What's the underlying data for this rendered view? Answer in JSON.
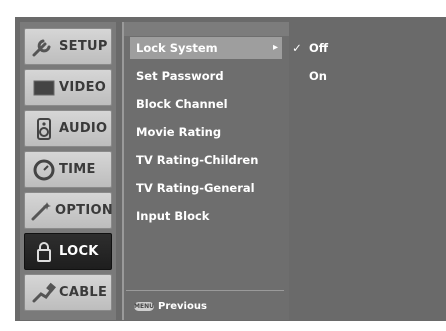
{
  "sidebar": {
    "items": [
      {
        "label": "SETUP",
        "icon": "wrench-icon",
        "active": false
      },
      {
        "label": "VIDEO",
        "icon": "tv-screen-icon",
        "active": false
      },
      {
        "label": "AUDIO",
        "icon": "speaker-icon",
        "active": false
      },
      {
        "label": "TIME",
        "icon": "clock-icon",
        "active": false
      },
      {
        "label": "OPTION",
        "icon": "wand-icon",
        "active": false
      },
      {
        "label": "LOCK",
        "icon": "padlock-icon",
        "active": true
      },
      {
        "label": "CABLE",
        "icon": "cable-plug-icon",
        "active": false
      }
    ]
  },
  "menu": {
    "items": [
      {
        "label": "Lock System",
        "selected": true
      },
      {
        "label": "Set Password",
        "selected": false
      },
      {
        "label": "Block Channel",
        "selected": false
      },
      {
        "label": "Movie Rating",
        "selected": false
      },
      {
        "label": "TV Rating-Children",
        "selected": false
      },
      {
        "label": "TV Rating-General",
        "selected": false
      },
      {
        "label": "Input Block",
        "selected": false
      }
    ],
    "footer_key": "MENU",
    "footer_label": "Previous"
  },
  "options": {
    "items": [
      {
        "label": "Off",
        "checked": true
      },
      {
        "label": "On",
        "checked": false
      }
    ]
  },
  "colors": {
    "panel_bg": "#6a6a6a",
    "selected_bg": "#9e9e9e",
    "active_tab": "#1e1e1e",
    "tab_bg": "#cccccc"
  }
}
